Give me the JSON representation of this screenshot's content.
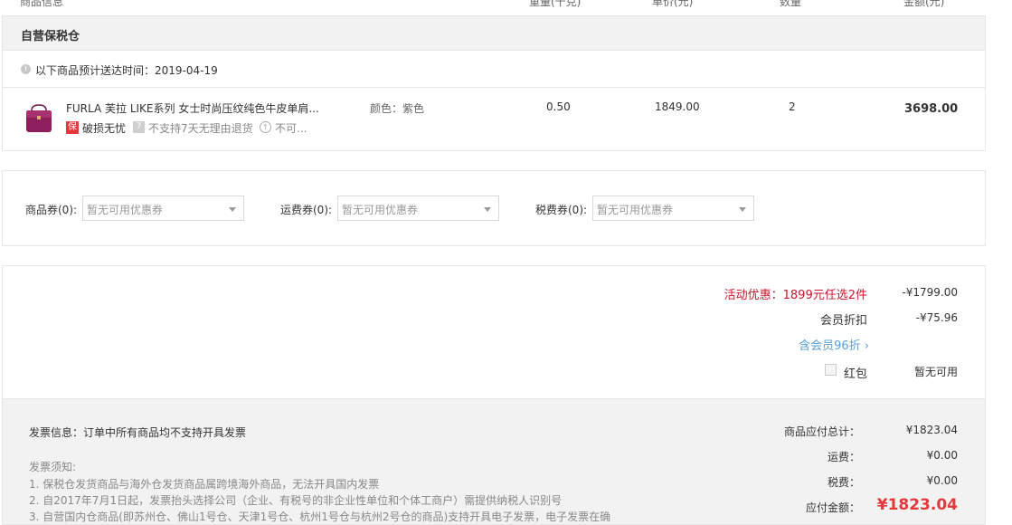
{
  "table_header": {
    "product": "商品信息",
    "weight": "重量(千克)",
    "price": "单价(元)",
    "qty": "数量",
    "amount": "金额(元)"
  },
  "warehouse": {
    "title": "自营保税仓",
    "delivery_text": "以下商品预计送达时间：2019-04-19",
    "product": {
      "name": "FURLA 芙拉 LIKE系列 女士时尚压纹纯色牛皮单肩...",
      "color": "颜色：紫色",
      "weight": "0.50",
      "price": "1849.00",
      "qty": "2",
      "amount": "3698.00",
      "bao_icon": "保",
      "tag1": "破损无忧",
      "seven_icon": "7",
      "tag2": "不支持7天无理由退货",
      "tag3": "不可..."
    }
  },
  "coupons": {
    "goods_label": "商品券(0):",
    "goods_value": "暂无可用优惠券",
    "shipping_label": "运费券(0):",
    "shipping_value": "暂无可用优惠券",
    "tax_label": "税费券(0):",
    "tax_value": "暂无可用优惠券"
  },
  "discounts": {
    "promo_label": "活动优惠：1899元任选2件",
    "promo_value": "-¥1799.00",
    "member_label": "会员折扣",
    "member_value": "-¥75.96",
    "member_link": "含会员96折 ›",
    "redpack_label": "红包",
    "redpack_value": "暂无可用"
  },
  "summary": {
    "invoice_info": "发票信息：订单中所有商品均不支持开具发票",
    "notes_title": "发票须知:",
    "notes": [
      "1. 保税仓发货商品与海外仓发货商品属跨境海外商品，无法开具国内发票",
      "2. 自2017年7月1日起，发票抬头选择公司（企业、有税号的非企业性单位和个体工商户）需提供纳税人识别号",
      "3. 自营国内仓商品(即苏州仓、佛山1号仓、天津1号仓、杭州1号仓与杭州2号仓的商品)支持开具电子发票，电子发票在确"
    ],
    "total_label": "商品应付总计：",
    "total_value": "¥1823.04",
    "shipping_label": "运费：",
    "shipping_value": "¥0.00",
    "tax_label": "税费：",
    "tax_value": "¥0.00",
    "payable_label": "应付金额：",
    "payable_value": "¥1823.04"
  },
  "colors": {
    "accent_red": "#e4393c",
    "promo_red": "#c8162b",
    "link_blue": "#5aa0d6"
  }
}
